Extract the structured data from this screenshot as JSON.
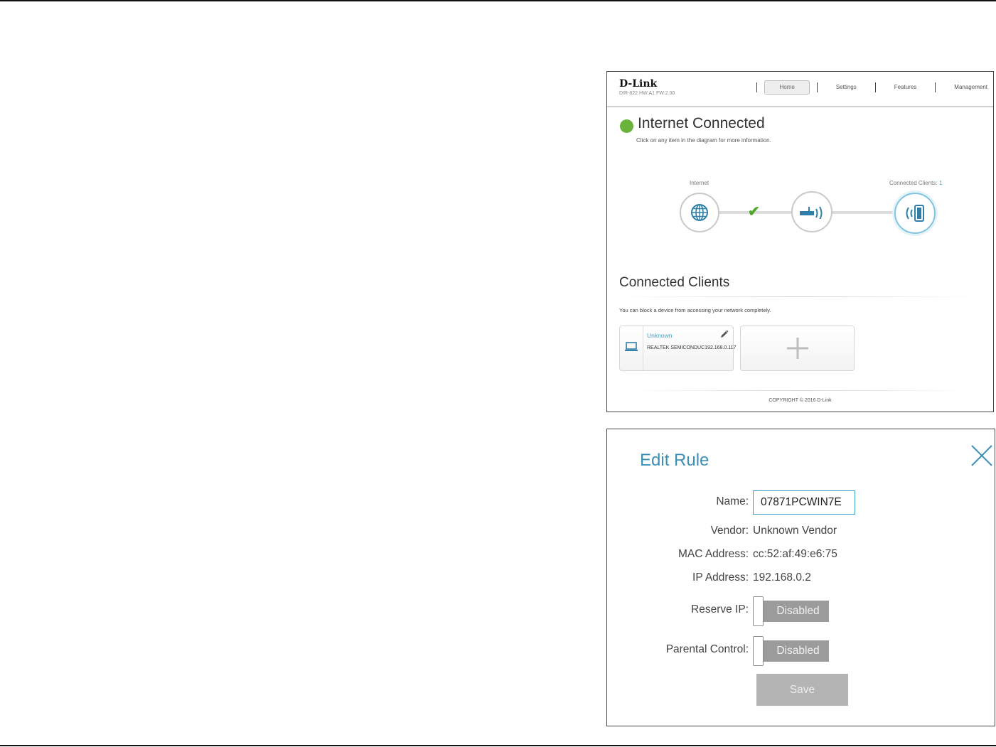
{
  "router": {
    "brand": "D-Link",
    "model": "DIR-822 HW:A1 FW:2.00",
    "nav": [
      {
        "label": "Home",
        "active": true
      },
      {
        "label": "Settings",
        "active": false
      },
      {
        "label": "Features",
        "active": false
      },
      {
        "label": "Management",
        "active": false
      }
    ],
    "status_title": "Internet Connected",
    "status_color": "#69b23c",
    "status_hint": "Click on any item in the diagram for more information.",
    "diagram": {
      "internet_label": "Internet",
      "clients_label": "Connected Clients:",
      "clients_count": "1",
      "icons": [
        "globe-icon",
        "check-icon",
        "router-icon",
        "wireless-client-icon"
      ]
    },
    "connected_clients": {
      "title": "Connected Clients",
      "hint": "You can block a device from accessing your network completely.",
      "clients": [
        {
          "name": "Unknown",
          "vendor": "REALTEK SEMICONDUC192.168.0.117",
          "icon": "laptop-icon"
        }
      ],
      "add_icon": "plus-icon"
    },
    "copyright": "COPYRIGHT © 2016 D-Link"
  },
  "edit_rule": {
    "title": "Edit Rule",
    "accent": "#3c8fb6",
    "name_label": "Name:",
    "name_value": "07871PCWIN7E",
    "vendor_label": "Vendor:",
    "vendor_value": "Unknown Vendor",
    "mac_label": "MAC Address:",
    "mac_value": "cc:52:af:49:e6:75",
    "ip_label": "IP Address:",
    "ip_value": "192.168.0.2",
    "reserve_ip_label": "Reserve IP:",
    "reserve_ip_state": "Disabled",
    "parental_label": "Parental Control:",
    "parental_state": "Disabled",
    "save_label": "Save"
  }
}
